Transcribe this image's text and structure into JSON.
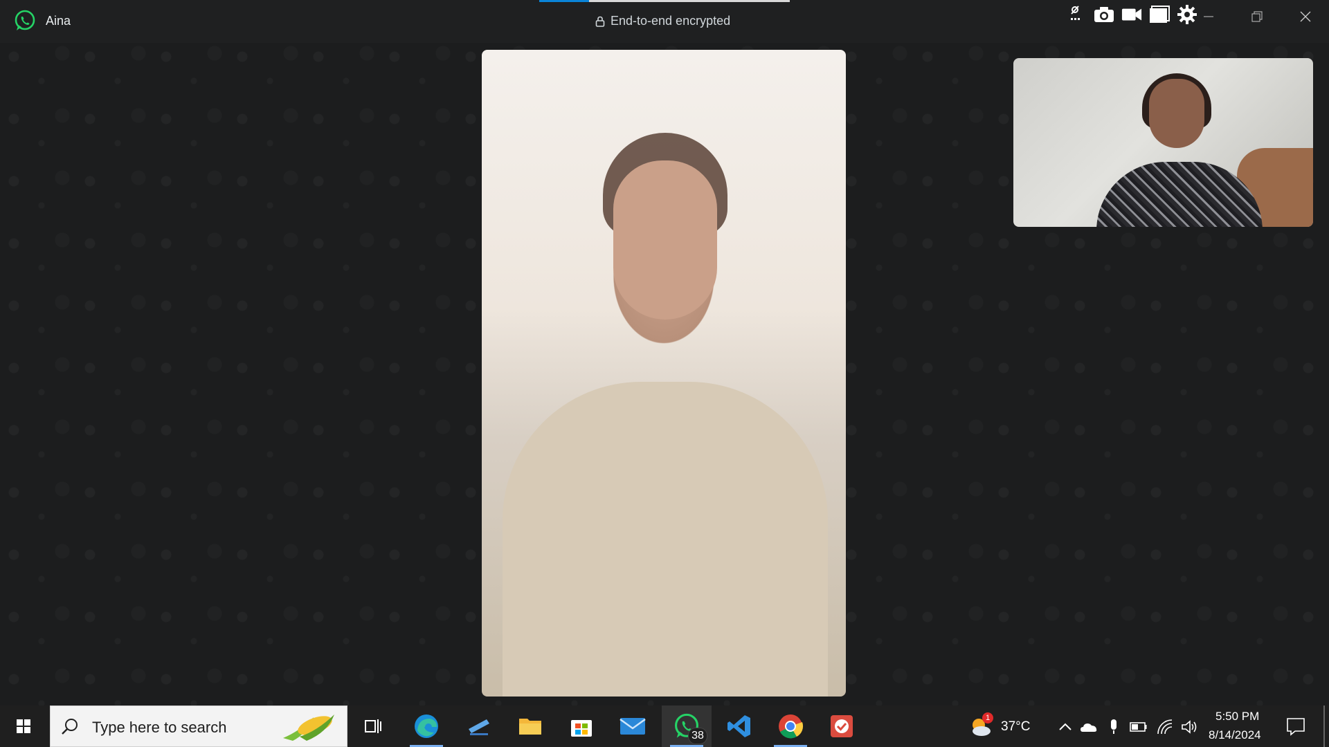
{
  "titlebar": {
    "contact_name": "Aina",
    "encryption_label": "End-to-end encrypted",
    "call_progress": 0.2
  },
  "toolbar_icons": [
    "screen-share-off-icon",
    "camera-icon",
    "video-camera-icon",
    "window-icon",
    "settings-gear-icon"
  ],
  "window_controls": [
    "minimize-icon",
    "restore-icon",
    "close-icon"
  ],
  "taskbar": {
    "search_placeholder": "Type here to search",
    "apps": [
      {
        "name": "task-view-icon"
      },
      {
        "name": "edge-icon"
      },
      {
        "name": "remote-desktop-icon"
      },
      {
        "name": "file-explorer-icon"
      },
      {
        "name": "microsoft-store-icon"
      },
      {
        "name": "mail-icon"
      },
      {
        "name": "whatsapp-icon",
        "badge": "38"
      },
      {
        "name": "vscode-icon"
      },
      {
        "name": "chrome-icon"
      },
      {
        "name": "todo-icon"
      }
    ],
    "weather_temp": "37°C",
    "weather_badge": "1",
    "time": "5:50 PM",
    "date": "8/14/2024"
  },
  "colors": {
    "whatsapp_green": "#25d366",
    "progress_blue": "#0a84d8",
    "taskbar_bg": "#1f1f1f"
  }
}
